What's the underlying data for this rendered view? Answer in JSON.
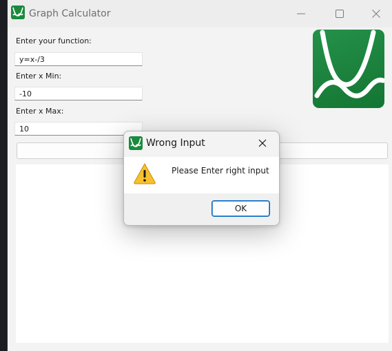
{
  "window": {
    "title": "Graph Calculator",
    "controls": [
      "minimize-icon",
      "maximize-icon",
      "close-icon"
    ]
  },
  "form": {
    "function_label": "Enter your function:",
    "function_value": "y=x-/3",
    "xmin_label": "Enter x Min:",
    "xmin_value": "-10",
    "xmax_label": "Enter x Max:",
    "xmax_value": "10"
  },
  "logo": {
    "icon": "graph-calculator-logo-icon",
    "color": "#1a8a3e"
  },
  "dialog": {
    "title": "Wrong Input",
    "message": "Please Enter right input",
    "ok_label": "OK",
    "icon": "warning-icon"
  },
  "colors": {
    "brand_green": "#1a8a3e",
    "accent_blue": "#0067c0",
    "warning_yellow": "#f7c12e"
  }
}
